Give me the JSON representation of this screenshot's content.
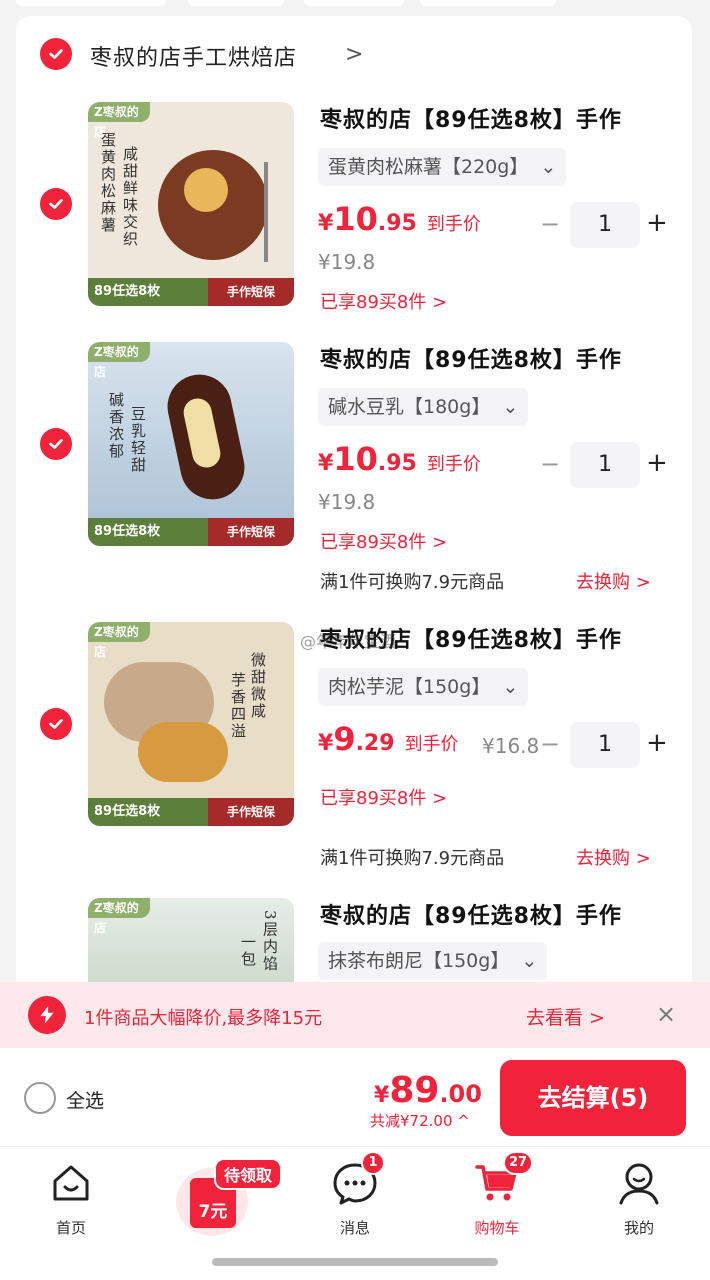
{
  "shop": {
    "name": "枣叔的店手工烘焙店",
    "arrow": ">"
  },
  "items": [
    {
      "title": "枣叔的店【89任选8枚】手作",
      "variant": "蛋黄肉松麻薯【220g】",
      "price_cur": "¥",
      "price_int": "10",
      "price_dec": ".95",
      "price_label": "到手价",
      "old_price": "¥19.8",
      "qty": "1",
      "promo": "已享89买8件 >",
      "thumb": {
        "brand": "Z枣叔的店",
        "vtext1": "蛋黄肉松麻薯",
        "vtext2": "咸甜鲜味交织",
        "tag1": "89任选8枚",
        "tag2": "手作短保"
      }
    },
    {
      "title": "枣叔的店【89任选8枚】手作",
      "variant": "碱水豆乳【180g】",
      "price_cur": "¥",
      "price_int": "10",
      "price_dec": ".95",
      "price_label": "到手价",
      "old_price": "¥19.8",
      "qty": "1",
      "promo": "已享89买8件 >",
      "swap": "满1件可换购7.9元商品",
      "swap_link": "去换购 >",
      "thumb": {
        "brand": "Z枣叔的店",
        "vtext1": "碱香浓郁",
        "vtext2": "豆乳轻甜",
        "tag1": "89任选8枚",
        "tag2": "手作短保"
      }
    },
    {
      "title": "枣叔的店【89任选8枚】手作",
      "variant": "肉松芋泥【150g】",
      "price_cur": "¥",
      "price_int": "9",
      "price_dec": ".29",
      "price_label": "到手价",
      "old_price": "¥16.8",
      "qty": "1",
      "promo": "已享89买8件 >",
      "swap": "满1件可换购7.9元商品",
      "swap_link": "去换购 >",
      "thumb": {
        "brand": "Z枣叔的店",
        "vtext1": "芋香四溢",
        "vtext2": "微甜微咸",
        "tag1": "89任选8枚",
        "tag2": "手作短保"
      }
    },
    {
      "title": "枣叔的店【89任选8枚】手作",
      "variant": "抹茶布朗尼【150g】",
      "thumb": {
        "brand": "Z枣叔的店",
        "vtext1": "一包",
        "vtext2": "3层内馅"
      }
    }
  ],
  "watermark": "@年年年宝酒",
  "banner": {
    "message": "1件商品大幅降价,最多降15元",
    "action": "去看看 >",
    "close": "×"
  },
  "checkout": {
    "select_all": "全选",
    "total_cur": "¥",
    "total_int": "89",
    "total_dec": ".00",
    "saved": "共减¥72.00 ^",
    "pay_button": "去结算(5)"
  },
  "tabbar": {
    "home": "首页",
    "coupon_pill": "待领取",
    "coupon_value": "7元",
    "messages": "消息",
    "messages_badge": "1",
    "cart": "购物车",
    "cart_badge": "27",
    "mine": "我的"
  },
  "colors": {
    "accent": "#f0233a",
    "banner_bg": "#fde9eb",
    "tag_green": "#5b7f3b",
    "tag_red": "#a52a2a"
  }
}
